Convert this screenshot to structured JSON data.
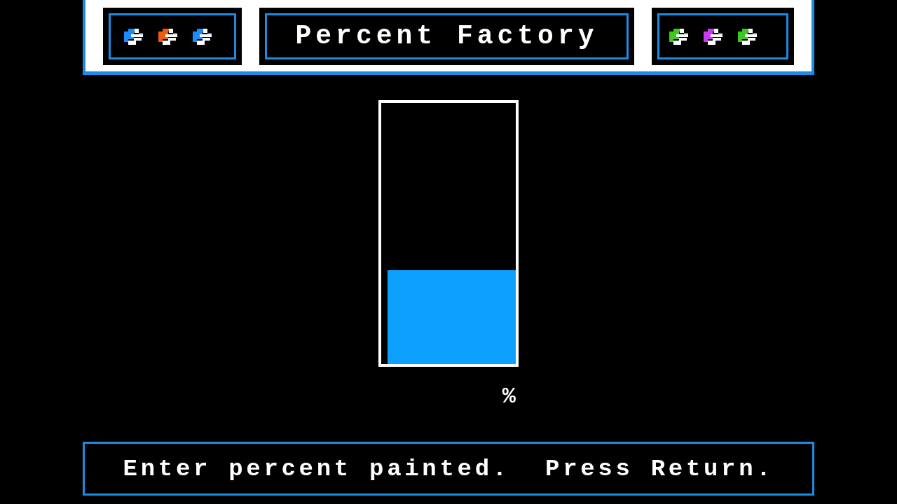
{
  "header": {
    "left_icons": [
      {
        "color": "#1a8cff"
      },
      {
        "color": "#f05a10"
      },
      {
        "color": "#1a8cff"
      }
    ],
    "title": "Percent Factory",
    "right_icons": [
      {
        "color": "#3cc81e"
      },
      {
        "color": "#c83cf0"
      },
      {
        "color": "#3cc81e"
      }
    ]
  },
  "tank": {
    "level": 0.36
  },
  "percent_entry": {
    "unit": "%"
  },
  "message": "Enter percent painted.  Press Return."
}
